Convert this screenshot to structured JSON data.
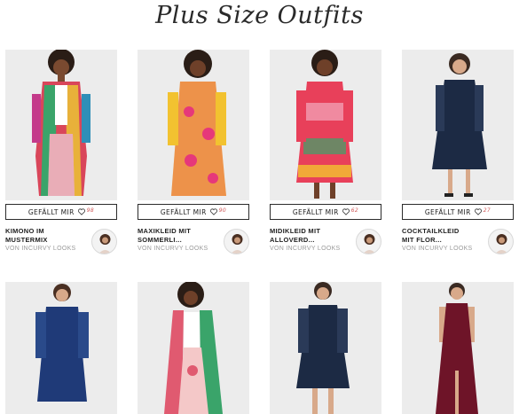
{
  "page": {
    "title": "Plus Size Outfits"
  },
  "colors": {
    "card_bg": "#ececec",
    "like_count": "#d05a5a",
    "author": "#9a9a9a"
  },
  "like_button_label": "GEFÄLLT MIR",
  "cards": [
    {
      "title_line1": "KIMONO IM",
      "title_line2": "MUSTERMIX",
      "author": "VON INCURVY LOOKS",
      "likes": "98",
      "outfit": "multicolor patterned kimono set"
    },
    {
      "title_line1": "MAXIKLEID MIT",
      "title_line2": "SOMMERLI...",
      "author": "VON INCURVY LOOKS",
      "likes": "90",
      "outfit": "yellow-pink maxi dress"
    },
    {
      "title_line1": "MIDIKLEID MIT",
      "title_line2": "ALLOVERD...",
      "author": "VON INCURVY LOOKS",
      "likes": "62",
      "outfit": "red-pink print midi dress"
    },
    {
      "title_line1": "COCKTAILKLEID",
      "title_line2": "MIT FLOR...",
      "author": "VON INCURVY LOOKS",
      "likes": "27",
      "outfit": "navy cocktail dress"
    },
    {
      "outfit": "navy lace dress"
    },
    {
      "outfit": "floral kimono with white top"
    },
    {
      "outfit": "navy chiffon dress"
    },
    {
      "outfit": "burgundy maxi dress"
    }
  ]
}
